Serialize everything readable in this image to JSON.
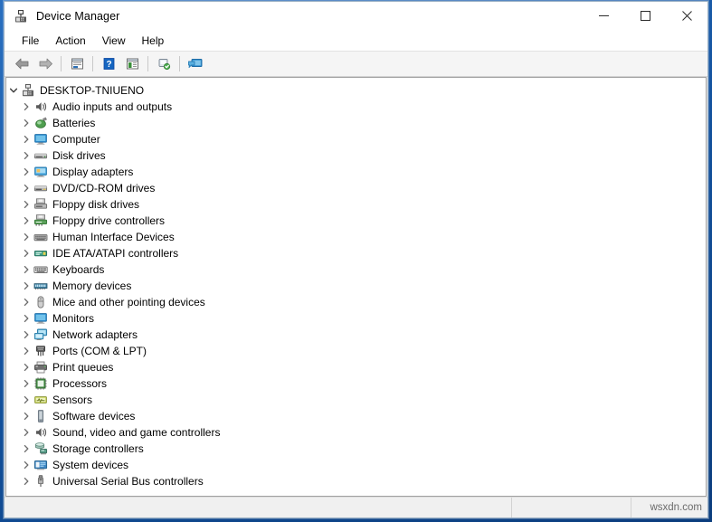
{
  "window": {
    "title": "Device Manager",
    "title_icon": "device-manager-icon",
    "caption_buttons": [
      {
        "name": "minimize-button",
        "glyph": "minimize"
      },
      {
        "name": "maximize-button",
        "glyph": "maximize"
      },
      {
        "name": "close-button",
        "glyph": "close"
      }
    ]
  },
  "menubar": {
    "items": [
      {
        "label": "File",
        "name": "menu-file"
      },
      {
        "label": "Action",
        "name": "menu-action"
      },
      {
        "label": "View",
        "name": "menu-view"
      },
      {
        "label": "Help",
        "name": "menu-help"
      }
    ]
  },
  "toolbar": {
    "buttons": [
      {
        "name": "back-button",
        "icon": "back-arrow-icon"
      },
      {
        "name": "forward-button",
        "icon": "forward-arrow-icon"
      },
      {
        "name": "separator-1",
        "icon": "separator"
      },
      {
        "name": "properties-button",
        "icon": "properties-icon"
      },
      {
        "name": "separator-2",
        "icon": "separator"
      },
      {
        "name": "help-button",
        "icon": "help-question-icon"
      },
      {
        "name": "show-hide-console-tree-button",
        "icon": "console-tree-icon"
      },
      {
        "name": "separator-3",
        "icon": "separator"
      },
      {
        "name": "scan-hardware-changes-button",
        "icon": "scan-hardware-icon"
      },
      {
        "name": "separator-4",
        "icon": "separator"
      },
      {
        "name": "update-driver-button",
        "icon": "monitor-screen-icon"
      }
    ]
  },
  "tree": {
    "root": {
      "label": "DESKTOP-TNIUENO",
      "icon": "computer-root-icon",
      "expanded": true
    },
    "nodes": [
      {
        "label": "Audio inputs and outputs",
        "icon": "speaker-icon",
        "color": "#5a5a5a"
      },
      {
        "label": "Batteries",
        "icon": "battery-icon",
        "color": "#3f8f3f"
      },
      {
        "label": "Computer",
        "icon": "monitor-icon",
        "color": "#3aa0dc"
      },
      {
        "label": "Disk drives",
        "icon": "disk-drive-icon",
        "color": "#777777"
      },
      {
        "label": "Display adapters",
        "icon": "display-adapter-icon",
        "color": "#5fb8e8"
      },
      {
        "label": "DVD/CD-ROM drives",
        "icon": "dvd-drive-icon",
        "color": "#8a8a8a"
      },
      {
        "label": "Floppy disk drives",
        "icon": "floppy-disk-icon",
        "color": "#8a8a8a"
      },
      {
        "label": "Floppy drive controllers",
        "icon": "floppy-controller-icon",
        "color": "#5c9f5c"
      },
      {
        "label": "Human Interface Devices",
        "icon": "hid-icon",
        "color": "#9a9a9a"
      },
      {
        "label": "IDE ATA/ATAPI controllers",
        "icon": "ide-controller-icon",
        "color": "#3f9f7f"
      },
      {
        "label": "Keyboards",
        "icon": "keyboard-icon",
        "color": "#7a7a7a"
      },
      {
        "label": "Memory devices",
        "icon": "memory-icon",
        "color": "#3c7a9e"
      },
      {
        "label": "Mice and other pointing devices",
        "icon": "mouse-icon",
        "color": "#8a8a8a"
      },
      {
        "label": "Monitors",
        "icon": "monitor-icon",
        "color": "#3aa0dc"
      },
      {
        "label": "Network adapters",
        "icon": "network-adapter-icon",
        "color": "#5aa8cf"
      },
      {
        "label": "Ports (COM & LPT)",
        "icon": "port-icon",
        "color": "#5a5a5a"
      },
      {
        "label": "Print queues",
        "icon": "printer-icon",
        "color": "#6f6f6f"
      },
      {
        "label": "Processors",
        "icon": "processor-icon",
        "color": "#4b8f4b"
      },
      {
        "label": "Sensors",
        "icon": "sensor-icon",
        "color": "#b8c45a"
      },
      {
        "label": "Software devices",
        "icon": "software-device-icon",
        "color": "#8f9aa3"
      },
      {
        "label": "Sound, video and game controllers",
        "icon": "speaker-icon",
        "color": "#5a5a5a"
      },
      {
        "label": "Storage controllers",
        "icon": "storage-controller-icon",
        "color": "#6f9f8f"
      },
      {
        "label": "System devices",
        "icon": "system-device-icon",
        "color": "#3f87c4"
      },
      {
        "label": "Universal Serial Bus controllers",
        "icon": "usb-icon",
        "color": "#6f6f6f"
      }
    ]
  },
  "statusbar": {
    "pane1": "",
    "pane2": "",
    "watermark": "wsxdn.com"
  }
}
